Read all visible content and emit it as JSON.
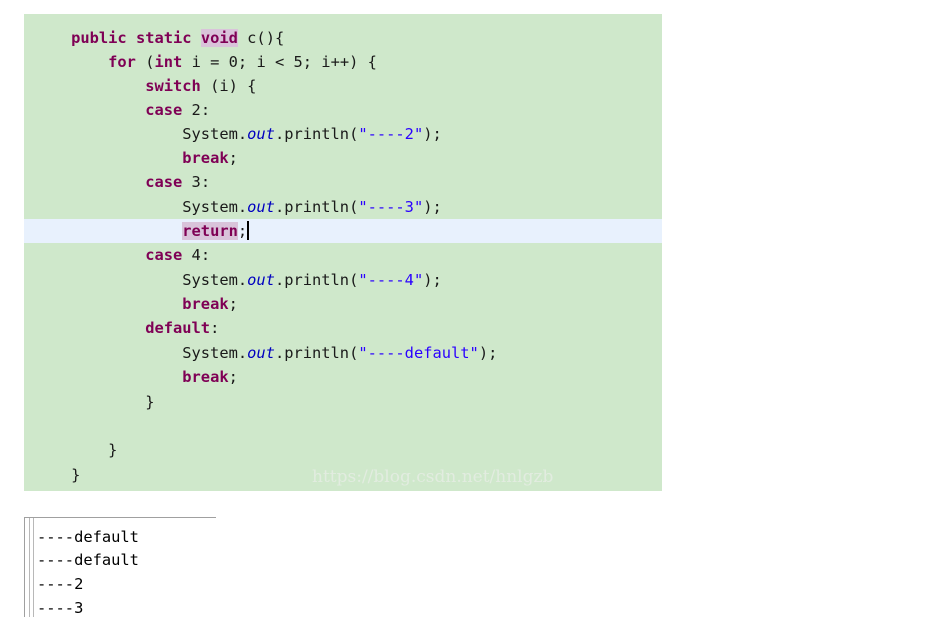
{
  "editor": {
    "lines": [
      [
        {
          "t": "    "
        },
        {
          "t": "public static ",
          "c": "kw"
        },
        {
          "t": "void",
          "c": "kw kw-hl"
        },
        {
          "t": " c(){"
        }
      ],
      [
        {
          "t": "        "
        },
        {
          "t": "for",
          "c": "kw"
        },
        {
          "t": " ("
        },
        {
          "t": "int",
          "c": "kw"
        },
        {
          "t": " i = 0; i < 5; i++) {"
        }
      ],
      [
        {
          "t": "            "
        },
        {
          "t": "switch",
          "c": "kw"
        },
        {
          "t": " (i) {"
        }
      ],
      [
        {
          "t": "            "
        },
        {
          "t": "case",
          "c": "kw"
        },
        {
          "t": " 2:"
        }
      ],
      [
        {
          "t": "                System."
        },
        {
          "t": "out",
          "c": "field"
        },
        {
          "t": ".println("
        },
        {
          "t": "\"----2\"",
          "c": "str"
        },
        {
          "t": ");"
        }
      ],
      [
        {
          "t": "                "
        },
        {
          "t": "break",
          "c": "kw"
        },
        {
          "t": ";"
        }
      ],
      [
        {
          "t": "            "
        },
        {
          "t": "case",
          "c": "kw"
        },
        {
          "t": " 3:"
        }
      ],
      [
        {
          "t": "                System."
        },
        {
          "t": "out",
          "c": "field"
        },
        {
          "t": ".println("
        },
        {
          "t": "\"----3\"",
          "c": "str"
        },
        {
          "t": ");"
        }
      ],
      [
        {
          "t": "                "
        },
        {
          "t": "return",
          "c": "kw kw-hl"
        },
        {
          "t": ";"
        }
      ],
      [
        {
          "t": "            "
        },
        {
          "t": "case",
          "c": "kw"
        },
        {
          "t": " 4:"
        }
      ],
      [
        {
          "t": "                System."
        },
        {
          "t": "out",
          "c": "field"
        },
        {
          "t": ".println("
        },
        {
          "t": "\"----4\"",
          "c": "str"
        },
        {
          "t": ");"
        }
      ],
      [
        {
          "t": "                "
        },
        {
          "t": "break",
          "c": "kw"
        },
        {
          "t": ";"
        }
      ],
      [
        {
          "t": "            "
        },
        {
          "t": "default",
          "c": "kw"
        },
        {
          "t": ":"
        }
      ],
      [
        {
          "t": "                System."
        },
        {
          "t": "out",
          "c": "field"
        },
        {
          "t": ".println("
        },
        {
          "t": "\"----default\"",
          "c": "str"
        },
        {
          "t": ");"
        }
      ],
      [
        {
          "t": "                "
        },
        {
          "t": "break",
          "c": "kw"
        },
        {
          "t": ";"
        }
      ],
      [
        {
          "t": "            }"
        }
      ],
      [
        {
          "t": ""
        }
      ],
      [
        {
          "t": "        }"
        }
      ],
      [
        {
          "t": "    }"
        }
      ]
    ],
    "current_line_index": 8,
    "watermark": "https://blog.csdn.net/hnlgzb",
    "colors": {
      "background": "#cfe8cb",
      "current_line": "#e8f1fd",
      "keyword": "#7f0055",
      "string": "#2a00ff",
      "static_field": "#0000c0",
      "occurrence_highlight": "#d9c3da"
    }
  },
  "console": {
    "lines": [
      "----default",
      "----default",
      "----2",
      "----3"
    ]
  }
}
